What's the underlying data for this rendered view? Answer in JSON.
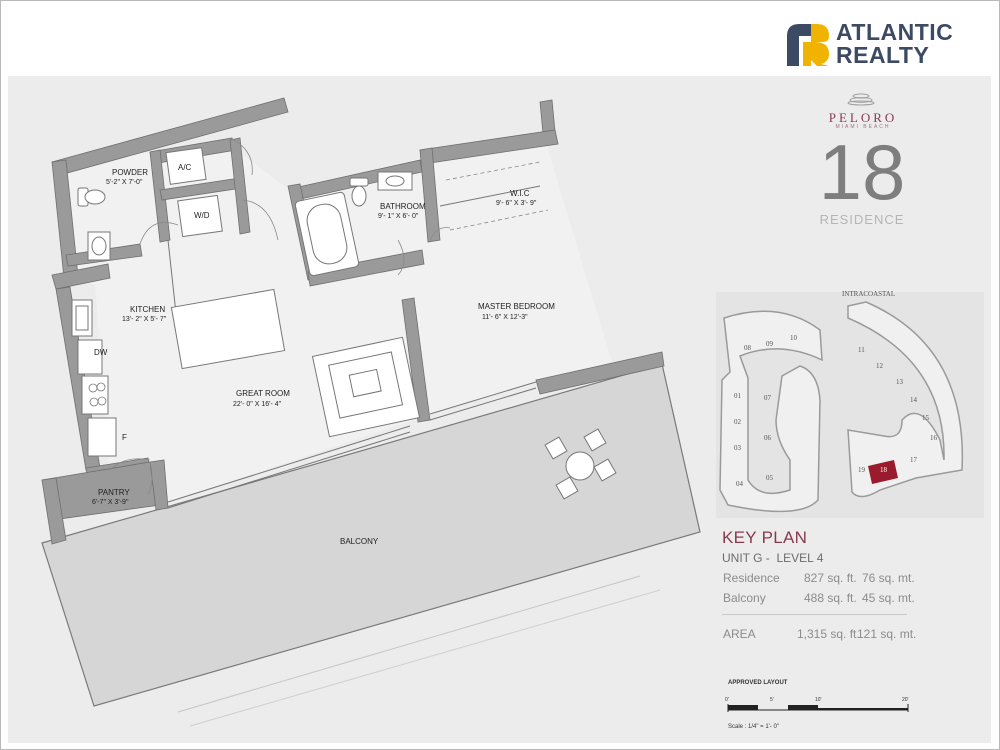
{
  "brand": {
    "line1": "ATLANTIC",
    "line2": "REALTY",
    "logo_colors": {
      "primary": "#3d4a63",
      "accent": "#f0b400"
    }
  },
  "project": {
    "name": "PELORO",
    "location": "MIAMI BEACH",
    "number": "18",
    "label": "RESIDENCE"
  },
  "rooms": {
    "powder": {
      "name": "POWDER",
      "dims": "5'-2\" X 7'-0\""
    },
    "ac": {
      "name": "A/C"
    },
    "wd": {
      "name": "W/D"
    },
    "bathroom": {
      "name": "BATHROOM",
      "dims": "9'- 1\" X 6'- 0\""
    },
    "wic": {
      "name": "W.I.C",
      "dims": "9'- 6\" X 3'- 9\""
    },
    "kitchen": {
      "name": "KITCHEN",
      "dims": "13'- 2\" X 5'- 7\""
    },
    "dw": {
      "name": "DW"
    },
    "fridge": {
      "name": "F"
    },
    "great_room": {
      "name": "GREAT ROOM",
      "dims": "22'- 0\" X 16'- 4\""
    },
    "master": {
      "name": "MASTER BEDROOM",
      "dims": "11'- 6\" X 12'-3\""
    },
    "pantry": {
      "name": "PANTRY",
      "dims": "6'-7\" X 3'-9\""
    },
    "balcony": {
      "name": "BALCONY"
    }
  },
  "key_plan": {
    "title": "KEY PLAN",
    "unit_line": "UNIT G -  LEVEL 4",
    "intracoastal": "INTRACOASTAL",
    "units_west": [
      "08",
      "09",
      "10",
      "01",
      "07",
      "02",
      "06",
      "03",
      "04",
      "05"
    ],
    "units_east": [
      "11",
      "12",
      "13",
      "14",
      "15",
      "16",
      "17",
      "18",
      "19"
    ],
    "highlight_unit": "18",
    "highlight_color": "#9a1b2c",
    "rows": [
      {
        "label": "Residence",
        "sqft": "827 sq. ft.",
        "sqm": "76 sq. mt."
      },
      {
        "label": "Balcony",
        "sqft": "488 sq. ft.",
        "sqm": "45 sq. mt."
      }
    ],
    "area": {
      "label": "AREA",
      "sqft": "1,315 sq. ft.",
      "sqm": "121 sq. mt."
    }
  },
  "scale": {
    "approved": "APPROVED LAYOUT",
    "ticks": [
      "0'",
      "5'",
      "10'",
      "20'"
    ],
    "text": "Scale : 1/4\" = 1'- 0\""
  }
}
